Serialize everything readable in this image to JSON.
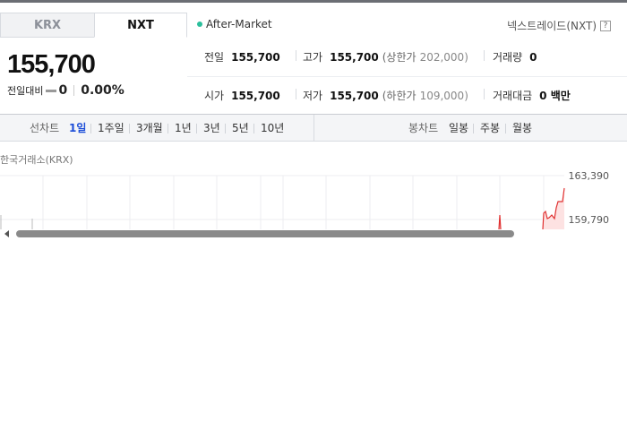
{
  "tabs": [
    {
      "label": "KRX",
      "active": false
    },
    {
      "label": "NXT",
      "active": true
    }
  ],
  "market_status": {
    "label": "After-Market",
    "dot_color": "#2bbf9c"
  },
  "nxt_link": {
    "label": "넥스트레이드(NXT)",
    "help_icon": "question-icon",
    "help_text": "?"
  },
  "price": {
    "current": "155,700",
    "change_label": "전일대비",
    "change_value": "0",
    "change_percent": "0.00%"
  },
  "stats": {
    "prev_close": {
      "label": "전일",
      "value": "155,700"
    },
    "high": {
      "label": "고가",
      "value": "155,700",
      "limit_label": "(상한가",
      "limit_value": "202,000",
      "limit_close": ")"
    },
    "volume": {
      "label": "거래량",
      "value": "0"
    },
    "open": {
      "label": "시가",
      "value": "155,700"
    },
    "low": {
      "label": "저가",
      "value": "155,700",
      "limit_label": "(하한가",
      "limit_value": "109,000",
      "limit_close": ")"
    },
    "amount": {
      "label": "거래대금",
      "value": "0 백만"
    }
  },
  "toolbar": {
    "line_label": "선차트",
    "periods": [
      "1일",
      "1주일",
      "3개월",
      "1년",
      "3년",
      "5년",
      "10년"
    ],
    "active_period": "1일",
    "candle_label": "봉차트",
    "candle_periods": [
      "일봉",
      "주봉",
      "월봉"
    ]
  },
  "chart": {
    "exchange_label": "한국거래소(KRX)",
    "y_ticks": [
      "163,390",
      "159,790"
    ],
    "line_color": "#e03131"
  }
}
